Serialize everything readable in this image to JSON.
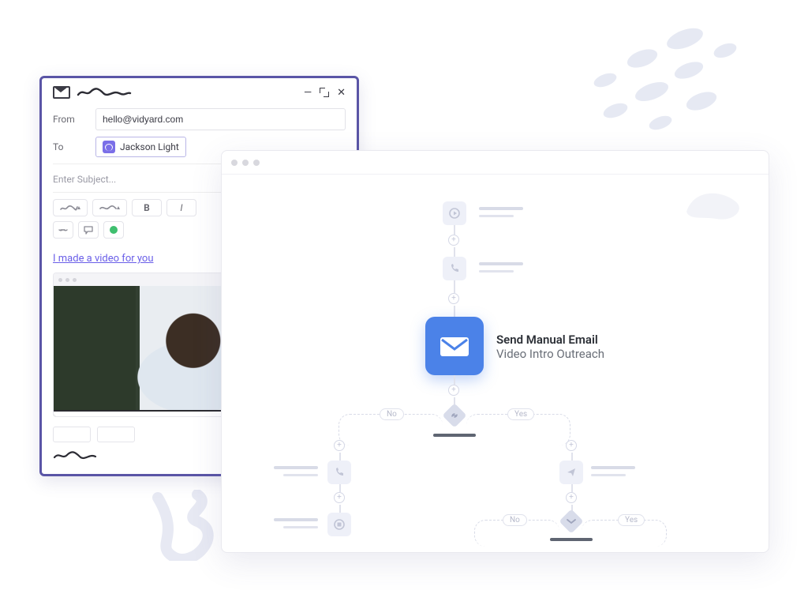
{
  "compose": {
    "from_label": "From",
    "from_value": "hello@vidyard.com",
    "to_label": "To",
    "to_chip": "Jackson Light",
    "subject_placeholder": "Enter Subject...",
    "subject_link": "I made a video for you",
    "toolbar": {
      "bold": "B",
      "italic": "I"
    },
    "window": {
      "minimize": "—",
      "close": "✕"
    }
  },
  "flow": {
    "main_node_title": "Send Manual Email",
    "main_node_subtitle": "Video Intro Outreach",
    "branch_no": "No",
    "branch_yes": "Yes"
  }
}
